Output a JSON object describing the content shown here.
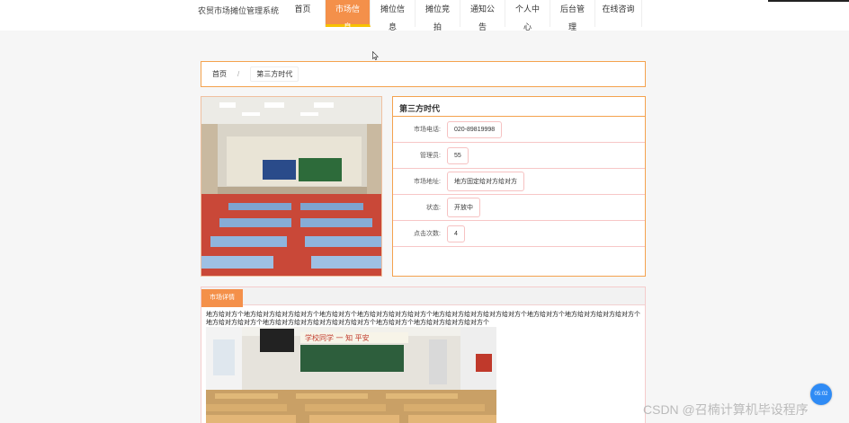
{
  "brand": {
    "title": "农贸市场摊位管理系统"
  },
  "nav": {
    "items": [
      {
        "label": "首页"
      },
      {
        "label": "市场信息"
      },
      {
        "label": "摊位信息"
      },
      {
        "label": "摊位竞拍"
      },
      {
        "label": "通知公告"
      },
      {
        "label": "个人中心"
      },
      {
        "label": "后台管理"
      },
      {
        "label": "在线咨询"
      }
    ],
    "active_index": 1
  },
  "breadcrumb": {
    "home": "首页",
    "separator": "/",
    "current": "第三方时代"
  },
  "market": {
    "name": "第三方时代",
    "fields": [
      {
        "label": "市场电话:",
        "value": "020-89819998"
      },
      {
        "label": "管理员:",
        "value": "55"
      },
      {
        "label": "市场地址:",
        "value": "地方固定给对方给对方"
      },
      {
        "label": "状态:",
        "value": "开放中"
      },
      {
        "label": "点击次数:",
        "value": "4"
      }
    ]
  },
  "detail": {
    "tab_label": "市场详情",
    "text": "地方给对方个地方给对方给对方给对方个地方给对方个地方给对方给对方给对方个地方给对方给对方给对方给对方个地方给对方个地方给对方给对方给对方个地方给对方给对方个地方给对方给对方给对方给对方给对方个地方给对方个地方给对方给对方给对方个",
    "banner_text": "学校同学 一 知 平安"
  },
  "overlay": {
    "timer": "05:02",
    "watermark": "CSDN @召楠计算机毕设程序"
  },
  "colors": {
    "accent": "#f4904a",
    "active_underline": "#f7c200",
    "border": "#f4a24e",
    "timer": "#2f8bf5"
  }
}
